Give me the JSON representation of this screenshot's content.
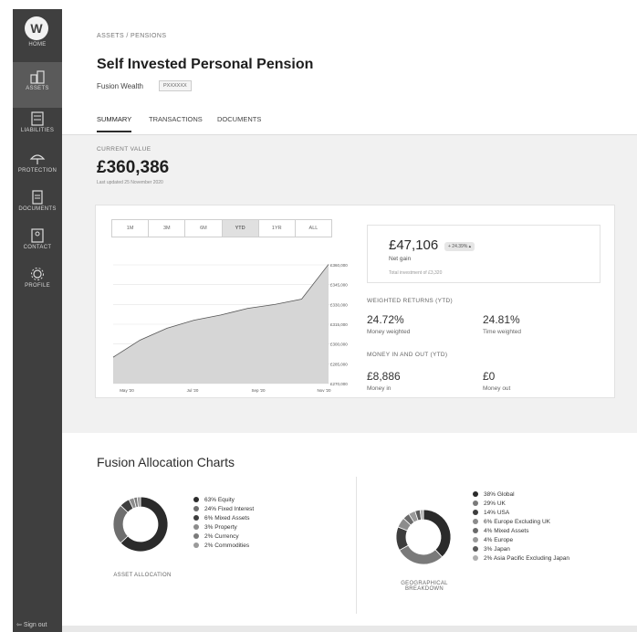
{
  "nav": {
    "logo_label": "HOME",
    "items": [
      {
        "label": "ASSETS"
      },
      {
        "label": "LIABILITIES"
      },
      {
        "label": "PROTECTION"
      },
      {
        "label": "DOCUMENTS"
      },
      {
        "label": "CONTACT"
      },
      {
        "label": "PROFILE"
      }
    ],
    "signout": "Sign out"
  },
  "header": {
    "breadcrumb": "ASSETS / PENSIONS",
    "title": "Self Invested Personal Pension",
    "provider": "Fusion Wealth",
    "reference": "PXXXXXX",
    "tabs": [
      "SUMMARY",
      "TRANSACTIONS",
      "DOCUMENTS"
    ]
  },
  "summary": {
    "current_value_label": "CURRENT VALUE",
    "current_value": "£360,386",
    "last_updated": "Last updated 25 November 2020",
    "range_buttons": [
      "1M",
      "3M",
      "6M",
      "YTD",
      "1YR",
      "ALL"
    ],
    "gain": {
      "value": "£47,106",
      "pill": "+ 24.39% ▴",
      "label": "Net gain",
      "invested": "Total investment of £3,320"
    },
    "weighted_returns_label": "WEIGHTED RETURNS (YTD)",
    "money_weighted": {
      "value": "24.72%",
      "label": "Money weighted"
    },
    "time_weighted": {
      "value": "24.81%",
      "label": "Time weighted"
    },
    "money_in_out_label": "MONEY IN AND OUT (YTD)",
    "money_in": {
      "value": "£8,886",
      "label": "Money in"
    },
    "money_out": {
      "value": "£0",
      "label": "Money out"
    }
  },
  "chart_data": {
    "type": "area",
    "x": [
      "Apr '20",
      "May '20",
      "Jun '20",
      "Jul '20",
      "Aug '20",
      "Sep '20",
      "Oct '20",
      "Nov '20 (early)",
      "Nov '20 (late)"
    ],
    "series": [
      {
        "values": [
          290000,
          303000,
          312000,
          318000,
          322000,
          327000,
          330000,
          334000,
          360386
        ]
      }
    ],
    "x_ticks": [
      "May '20",
      "Jul '20",
      "Sep '20",
      "Nov '20"
    ],
    "y_ticks": [
      "£270,000",
      "£285,000",
      "£300,000",
      "£315,000",
      "£330,000",
      "£345,000",
      "£360,000"
    ],
    "ylim": [
      270000,
      360000
    ],
    "grid": true,
    "fill_color": "#d6d6d6",
    "line_color": "#555555"
  },
  "allocation": {
    "title": "Fusion Allocation Charts",
    "asset": {
      "caption": "ASSET ALLOCATION",
      "items": [
        {
          "label": "63% Equity",
          "pct": 63,
          "color": "#2b2b2b"
        },
        {
          "label": "24% Fixed Interest",
          "pct": 24,
          "color": "#6e6e6e"
        },
        {
          "label": "6% Mixed Assets",
          "pct": 6,
          "color": "#3d3d3d"
        },
        {
          "label": "3% Property",
          "pct": 3,
          "color": "#8c8c8c"
        },
        {
          "label": "2% Currency",
          "pct": 2,
          "color": "#7a7a7a"
        },
        {
          "label": "2% Commodities",
          "pct": 2,
          "color": "#9a9a9a"
        }
      ]
    },
    "geo": {
      "caption_line1": "GEOGRAPHICAL",
      "caption_line2": "BREAKDOWN",
      "items": [
        {
          "label": "38% Global",
          "pct": 38,
          "color": "#2b2b2b"
        },
        {
          "label": "29% UK",
          "pct": 29,
          "color": "#7a7a7a"
        },
        {
          "label": "14% USA",
          "pct": 14,
          "color": "#3d3d3d"
        },
        {
          "label": "6% Europe Excluding UK",
          "pct": 6,
          "color": "#8c8c8c"
        },
        {
          "label": "4% Mixed Assets",
          "pct": 4,
          "color": "#6a6a6a"
        },
        {
          "label": "4% Europe",
          "pct": 4,
          "color": "#9a9a9a"
        },
        {
          "label": "3% Japan",
          "pct": 3,
          "color": "#5a5a5a"
        },
        {
          "label": "2% Asia Pacific Excluding Japan",
          "pct": 2,
          "color": "#b0b0b0"
        }
      ]
    }
  }
}
